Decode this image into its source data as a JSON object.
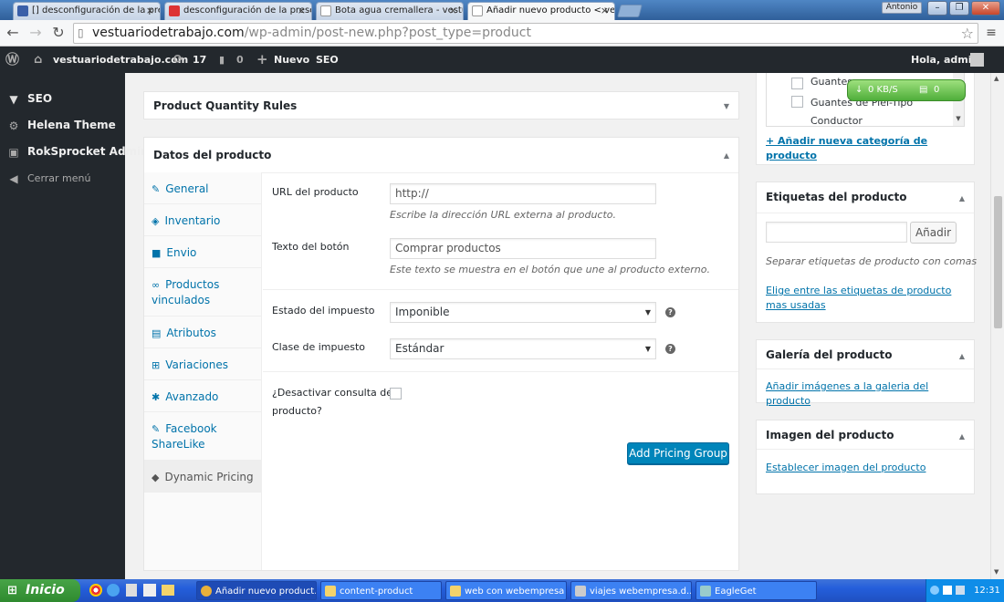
{
  "browser": {
    "tabs": [
      {
        "title": "[] desconfiguración de la pre",
        "fav": "gmail-icon"
      },
      {
        "title": "desconfiguración de la prese",
        "fav": "forum-icon"
      },
      {
        "title": "Bota agua cremallera - vestu",
        "fav": "page-icon"
      },
      {
        "title": "Añadir nuevo producto < ves",
        "fav": "page-icon"
      }
    ],
    "tab_close": "×",
    "user": "Antonio",
    "url_host": "vestuariodetrabajo.com",
    "url_path": "/wp-admin/post-new.php?post_type=product"
  },
  "adminbar": {
    "site": "vestuariodetrabajo.com",
    "updates": "17",
    "comments": "0",
    "new_label": "Nuevo",
    "seo": "SEO",
    "greeting": "Hola, admin"
  },
  "leftmenu": {
    "items": [
      "SEO",
      "Helena Theme",
      "RokSprocket Admin"
    ],
    "collapse": "Cerrar menú"
  },
  "qty_rules": {
    "title": "Product Quantity Rules"
  },
  "product_data": {
    "title": "Datos del producto",
    "tabs": [
      "General",
      "Inventario",
      "Envio",
      "Productos vinculados",
      "Atributos",
      "Variaciones",
      "Avanzado",
      "Facebook ShareLike",
      "Dynamic Pricing"
    ],
    "url_label": "URL del producto",
    "url_placeholder": "http://",
    "url_desc": "Escribe la dirección URL externa al producto.",
    "btn_text_label": "Texto del botón",
    "btn_text_placeholder": "Comprar productos",
    "btn_text_desc": "Este texto se muestra en el botón que une al producto externo.",
    "tax_status_label": "Estado del impuesto",
    "tax_status_value": "Imponible",
    "tax_class_label": "Clase de impuesto",
    "tax_class_value": "Estándar",
    "disable_query_label_1": "¿Desactivar consulta de",
    "disable_query_label_2": "producto?",
    "add_pricing_group": "Add Pricing Group",
    "help": "?"
  },
  "categories": {
    "items": [
      "Guantes",
      "Guantes de Piel-Tipo Conductor"
    ],
    "add_new": "+ Añadir nueva categoría de producto",
    "speed": "0 KB/S",
    "speed_count": "0"
  },
  "tags": {
    "title": "Etiquetas del producto",
    "add_button": "Añadir",
    "hint": "Separar etiquetas de producto con comas",
    "choose_link": "Elige entre las etiquetas de producto mas usadas"
  },
  "gallery": {
    "title": "Galería del producto",
    "link": "Añadir imágenes a la galeria del producto"
  },
  "image": {
    "title": "Imagen del producto",
    "link": "Establecer imagen del producto"
  },
  "taskbar": {
    "start": "Inicio",
    "items": [
      "Añadir nuevo product...",
      "content-product",
      "web con webempresa",
      "viajes webempresa.d...",
      "EagleGet"
    ],
    "clock": "12:31"
  }
}
